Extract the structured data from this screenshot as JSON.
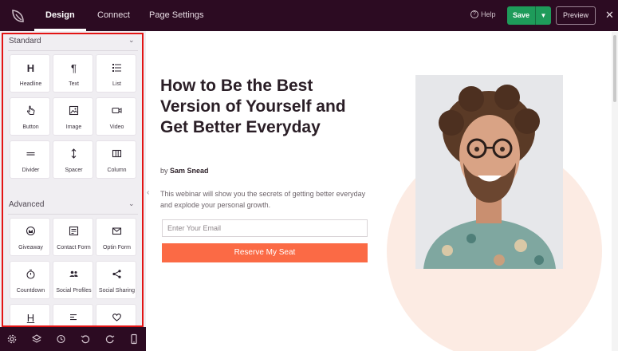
{
  "topbar": {
    "tabs": [
      {
        "label": "Design",
        "active": true
      },
      {
        "label": "Connect",
        "active": false
      },
      {
        "label": "Page Settings",
        "active": false
      }
    ],
    "help_label": "Help",
    "save_label": "Save",
    "preview_label": "Preview",
    "close_glyph": "✕"
  },
  "sidebar": {
    "standard": {
      "title": "Standard",
      "blocks": [
        {
          "label": "Headline",
          "icon": "headline-icon"
        },
        {
          "label": "Text",
          "icon": "paragraph-icon"
        },
        {
          "label": "List",
          "icon": "list-icon"
        },
        {
          "label": "Button",
          "icon": "pointer-icon"
        },
        {
          "label": "Image",
          "icon": "image-icon"
        },
        {
          "label": "Video",
          "icon": "video-icon"
        },
        {
          "label": "Divider",
          "icon": "divider-icon"
        },
        {
          "label": "Spacer",
          "icon": "spacer-icon"
        },
        {
          "label": "Column",
          "icon": "column-icon"
        }
      ]
    },
    "advanced": {
      "title": "Advanced",
      "blocks": [
        {
          "label": "Giveaway",
          "icon": "giveaway-icon"
        },
        {
          "label": "Contact Form",
          "icon": "contact-form-icon"
        },
        {
          "label": "Optin Form",
          "icon": "mail-icon"
        },
        {
          "label": "Countdown",
          "icon": "timer-icon"
        },
        {
          "label": "Social Profiles",
          "icon": "users-icon"
        },
        {
          "label": "Social Sharing",
          "icon": "share-icon"
        },
        {
          "label": "",
          "icon": "heading-underline-icon"
        },
        {
          "label": "",
          "icon": "align-icon"
        },
        {
          "label": "",
          "icon": "heart-icon"
        }
      ]
    },
    "bottom_tools": [
      "settings-icon",
      "layers-icon",
      "history-icon",
      "undo-icon",
      "redo-icon",
      "mobile-icon"
    ]
  },
  "canvas": {
    "headline": "How to Be the Best Version of Yourself and Get Better Everyday",
    "byline_prefix": "by",
    "byline_author": "Sam Snead",
    "description": "This webinar will show you the secrets of getting better everyday and explode your personal growth.",
    "email_placeholder": "Enter Your Email",
    "button_label": "Reserve My Seat"
  },
  "colors": {
    "topbar": "#2c0b22",
    "save": "#1e9b5a",
    "cta": "#fb6a45",
    "highlight_frame": "#e31414"
  }
}
